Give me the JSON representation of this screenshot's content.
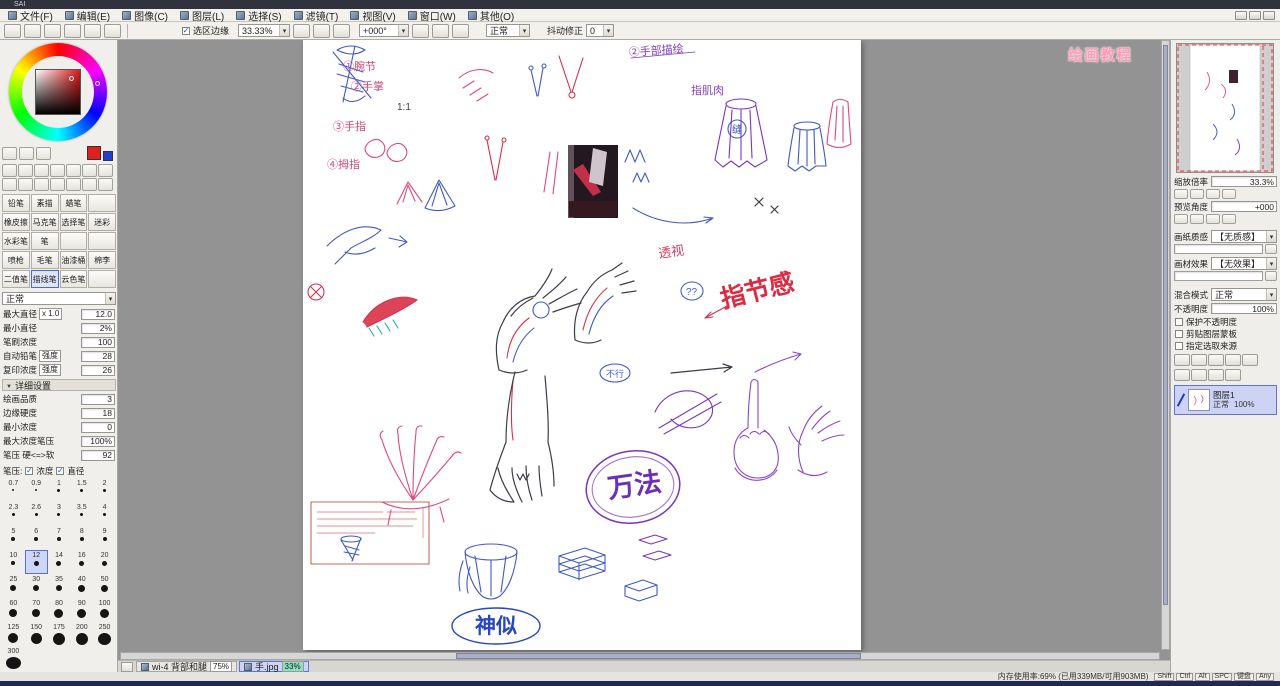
{
  "titlebar": {
    "title": "SAI"
  },
  "menubar": {
    "items": [
      {
        "label": "文件(F)"
      },
      {
        "label": "编辑(E)"
      },
      {
        "label": "图像(C)"
      },
      {
        "label": "图层(L)"
      },
      {
        "label": "选择(S)"
      },
      {
        "label": "滤镜(T)"
      },
      {
        "label": "视图(V)"
      },
      {
        "label": "窗口(W)"
      },
      {
        "label": "其他(O)"
      }
    ]
  },
  "toolbar": {
    "selection_edge": "选区边缘",
    "zoom": "33.33%",
    "angle": "+000°",
    "blend": "正常",
    "jitter_label": "抖动修正",
    "jitter": "0"
  },
  "left_panel": {
    "blend_mode": "正常",
    "brushes": [
      {
        "label": "铅笔"
      },
      {
        "label": "素描"
      },
      {
        "label": "蜡笔"
      },
      {
        "label": ""
      },
      {
        "label": "橡皮擦"
      },
      {
        "label": "马克笔"
      },
      {
        "label": "选择笔"
      },
      {
        "label": "迷彩"
      },
      {
        "label": "水彩笔"
      },
      {
        "label": "笔"
      },
      {
        "label": ""
      },
      {
        "label": ""
      },
      {
        "label": "喷枪"
      },
      {
        "label": "毛笔"
      },
      {
        "label": "油漆桶"
      },
      {
        "label": "棉李"
      },
      {
        "label": "二值笔"
      },
      {
        "label": "描线笔",
        "selected": true
      },
      {
        "label": "云色笔"
      },
      {
        "label": ""
      }
    ],
    "params_top": [
      {
        "label": "最大直径",
        "mid": "x 1.0",
        "value": "12.0"
      },
      {
        "label": "最小直径",
        "value": "2%"
      },
      {
        "label": "笔刷浓度",
        "value": "100"
      },
      {
        "label": "自动铅笔",
        "mid": "强度",
        "value": "28"
      },
      {
        "label": "复印浓度",
        "mid": "强度",
        "value": "26"
      }
    ],
    "detail_header": "详细设置",
    "params_detail": [
      {
        "label": "绘画品质",
        "value": "3"
      },
      {
        "label": "边缘硬度",
        "value": "18"
      },
      {
        "label": "最小浓度",
        "value": "0"
      },
      {
        "label": "最大浓度笔压",
        "value": "100%"
      },
      {
        "label": "笔压 硬<=>软",
        "value": "92"
      }
    ],
    "pressure_label": "笔压:",
    "pressure_checks": [
      {
        "label": "浓度"
      },
      {
        "label": "直径"
      }
    ],
    "sizes": [
      {
        "v": "0.7"
      },
      {
        "v": "0.9"
      },
      {
        "v": "1"
      },
      {
        "v": "1.5"
      },
      {
        "v": "2"
      },
      {
        "v": "2.3"
      },
      {
        "v": "2.6"
      },
      {
        "v": "3"
      },
      {
        "v": "3.5"
      },
      {
        "v": "4"
      },
      {
        "v": "5"
      },
      {
        "v": "6"
      },
      {
        "v": "7"
      },
      {
        "v": "8"
      },
      {
        "v": "9"
      },
      {
        "v": "10"
      },
      {
        "v": "12",
        "selected": true
      },
      {
        "v": "14"
      },
      {
        "v": "16"
      },
      {
        "v": "20"
      },
      {
        "v": "25"
      },
      {
        "v": "30"
      },
      {
        "v": "35"
      },
      {
        "v": "40"
      },
      {
        "v": "50"
      },
      {
        "v": "60"
      },
      {
        "v": "70"
      },
      {
        "v": "80"
      },
      {
        "v": "90"
      },
      {
        "v": "100"
      },
      {
        "v": "125"
      },
      {
        "v": "150"
      },
      {
        "v": "175"
      },
      {
        "v": "200"
      },
      {
        "v": "250"
      },
      {
        "v": "300"
      }
    ]
  },
  "right_panel": {
    "zoom_label": "缩放倍率",
    "zoom_value": "33.3%",
    "angle_label": "预览角度",
    "angle_value": "+000",
    "paper_label": "画纸质感",
    "paper_value": "【无质感】",
    "effect_label": "画材效果",
    "effect_value": "【无效果】",
    "blend_label": "混合模式",
    "blend_value": "正常",
    "opacity_label": "不透明度",
    "opacity_value": "100%",
    "checks": [
      {
        "label": "保护不透明度"
      },
      {
        "label": "剪贴图层蒙板"
      },
      {
        "label": "指定选取来源"
      }
    ],
    "layer": {
      "name": "图层1",
      "mode": "正常",
      "opacity": "100%"
    }
  },
  "tabs": [
    {
      "name": "wi-4 背部和腿",
      "zoom": "75%"
    },
    {
      "name": "手.jpg",
      "zoom": "33%",
      "selected": true
    }
  ],
  "statusbar": {
    "memory": "内存使用率:69% (已用339MB/可用903MB)",
    "keys": [
      {
        "k": "Shift"
      },
      {
        "k": "Ctrl"
      },
      {
        "k": "Alt"
      },
      {
        "k": "SPC"
      },
      {
        "k": "键盘"
      },
      {
        "k": "Any"
      }
    ]
  },
  "watermark": "绘画教程",
  "canvas": {
    "annotations": [
      {
        "t": "①腕节"
      },
      {
        "t": "②手掌"
      },
      {
        "t": "③手指"
      },
      {
        "t": "④拇指"
      },
      {
        "t": "1:1"
      },
      {
        "t": "②手部描绘"
      },
      {
        "t": "指肌肉"
      },
      {
        "t": "缝"
      },
      {
        "t": "指节感"
      },
      {
        "t": "透视"
      },
      {
        "t": "??"
      },
      {
        "t": "不行"
      },
      {
        "t": "万法"
      },
      {
        "t": "神似"
      }
    ]
  }
}
